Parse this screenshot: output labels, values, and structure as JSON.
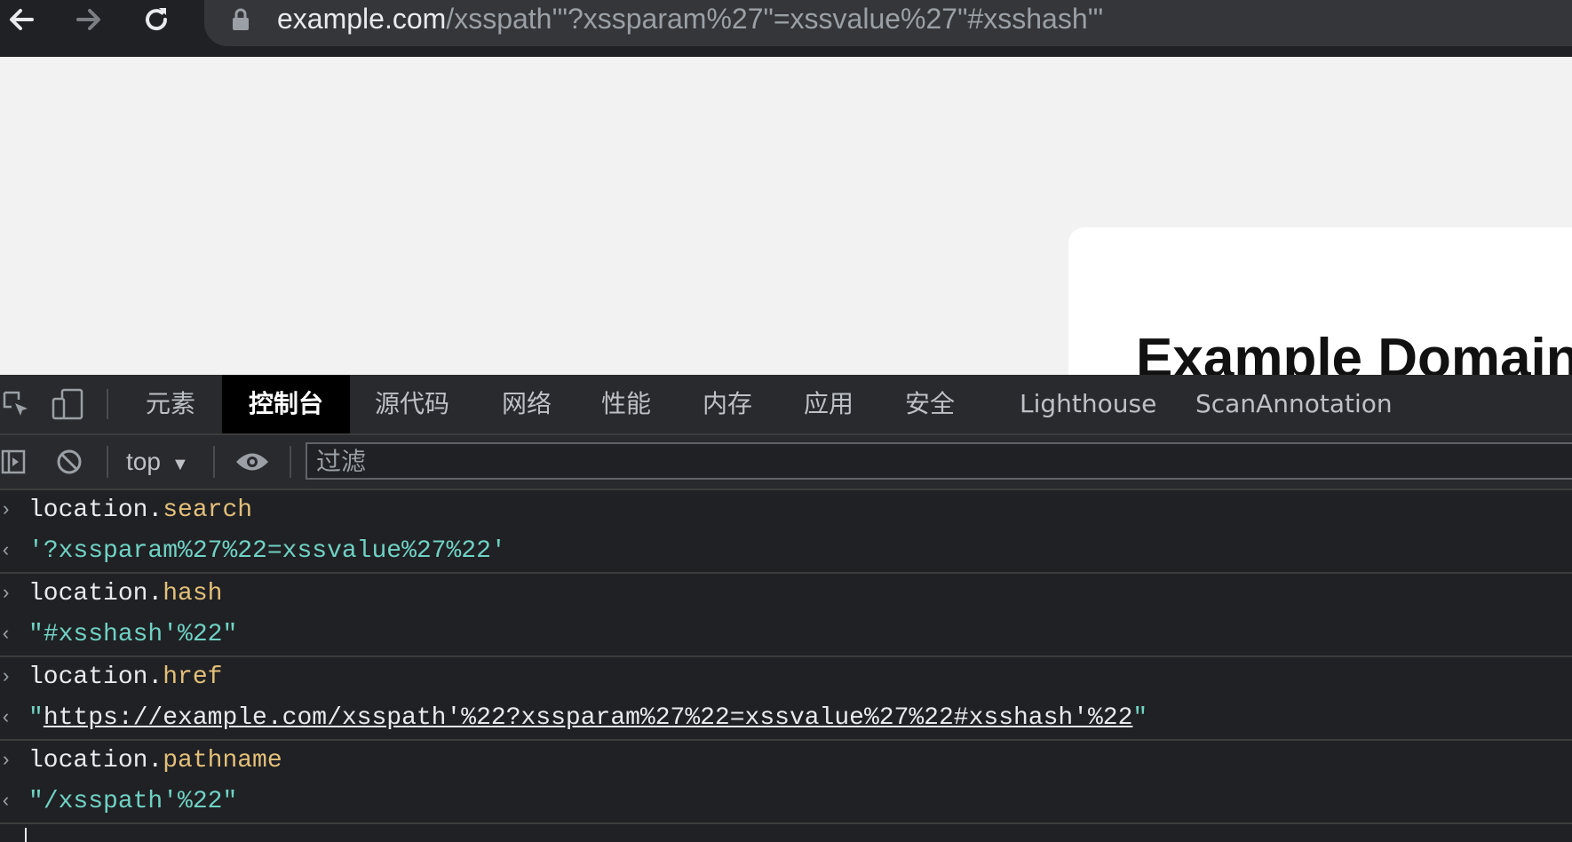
{
  "browser": {
    "url_domain": "example.com",
    "url_rest": "/xsspath'\"?xssparam%27\"=xssvalue%27\"#xsshash'\""
  },
  "page": {
    "card_title": "Example Domain"
  },
  "devtools": {
    "tabs": [
      {
        "label": "元素",
        "active": false
      },
      {
        "label": "控制台",
        "active": true
      },
      {
        "label": "源代码",
        "active": false
      },
      {
        "label": "网络",
        "active": false
      },
      {
        "label": "性能",
        "active": false
      },
      {
        "label": "内存",
        "active": false
      },
      {
        "label": "应用",
        "active": false
      },
      {
        "label": "安全",
        "active": false
      },
      {
        "label": "Lighthouse",
        "active": false
      },
      {
        "label": "ScanAnnotation",
        "active": false
      }
    ],
    "toolbar": {
      "context": "top",
      "filter_placeholder": "过滤"
    },
    "console": {
      "entries": [
        {
          "input_object": "location",
          "input_property": "search",
          "result_open": "'",
          "result_value": "?xssparam%27%22=xssvalue%27%22",
          "result_close": "'"
        },
        {
          "input_object": "location",
          "input_property": "hash",
          "result_open": "\"",
          "result_value": "#xsshash'%22",
          "result_close": "\""
        },
        {
          "input_object": "location",
          "input_property": "href",
          "result_open": "\"",
          "result_value": "https://example.com/xsspath'%22?xssparam%27%22=xssvalue%27%22#xsshash'%22",
          "result_close": "\""
        },
        {
          "input_object": "location",
          "input_property": "pathname",
          "result_open": "\"",
          "result_value": "/xsspath'%22",
          "result_close": "\""
        }
      ]
    }
  },
  "colors": {
    "devtools_bg": "#202124",
    "active_tab_bg": "#000000",
    "property_color": "#e3c07a",
    "string_color": "#6fd2c4"
  }
}
